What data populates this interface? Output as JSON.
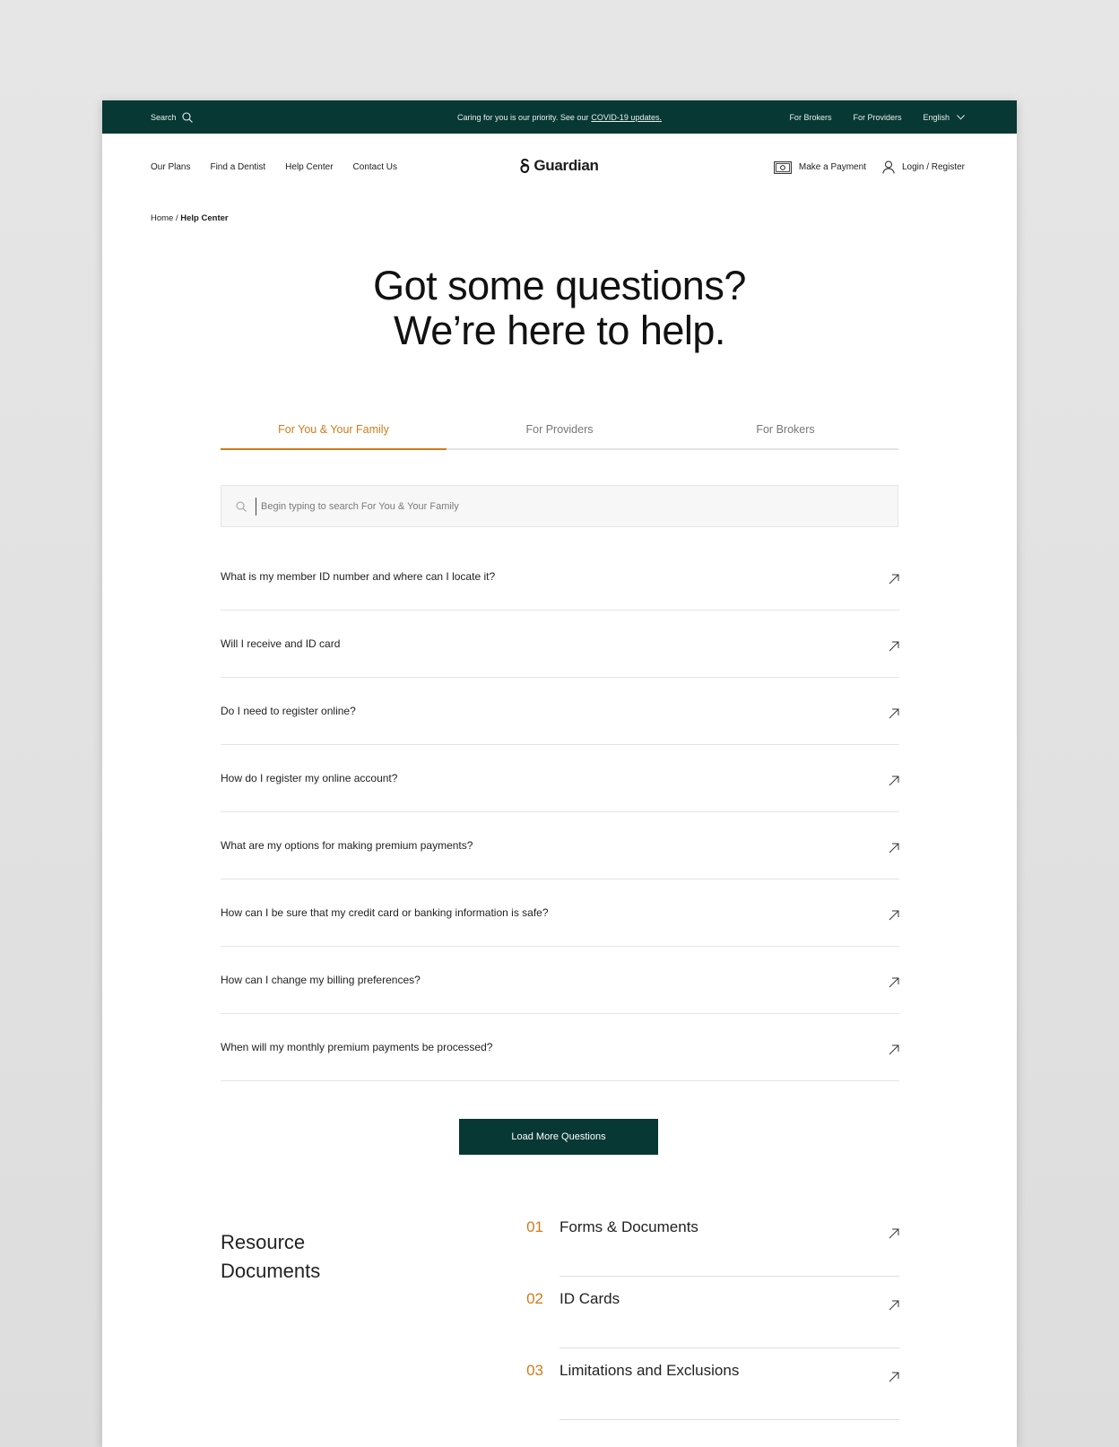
{
  "topbar": {
    "search_label": "Search",
    "notice_text": "Caring for you is our priority. See our",
    "notice_link": "COVID-19 updates.",
    "brokers": "For Brokers",
    "providers": "For Providers",
    "language": "English"
  },
  "nav": {
    "links": [
      "Our Plans",
      "Find a Dentist",
      "Help Center",
      "Contact Us"
    ],
    "logo": "Guardian",
    "payment": "Make a Payment",
    "login": "Login / Register"
  },
  "breadcrumb": {
    "home": "Home /",
    "current": "Help Center"
  },
  "hero": {
    "line1": "Got some questions?",
    "line2": "We’re here to help."
  },
  "tabs": [
    {
      "label": "For You & Your Family",
      "active": true
    },
    {
      "label": "For Providers",
      "active": false
    },
    {
      "label": "For Brokers",
      "active": false
    }
  ],
  "search": {
    "placeholder": "Begin typing to search For You & Your Family"
  },
  "faq": [
    "What is my member ID number and where can I locate it?",
    "Will I receive and ID card",
    "Do I need to register online?",
    "How do I register my online account?",
    "What are my options for making premium payments?",
    "How can I be sure that my credit card or banking information is safe?",
    "How can I change my billing preferences?",
    "When will my monthly premium payments be processed?"
  ],
  "load_more": "Load More Questions",
  "resources": {
    "title_line1": "Resource",
    "title_line2": "Documents",
    "items": [
      {
        "num": "01",
        "label": "Forms & Documents"
      },
      {
        "num": "02",
        "label": "ID Cards"
      },
      {
        "num": "03",
        "label": "Limitations and Exclusions"
      }
    ]
  },
  "colors": {
    "brand_green": "#073833",
    "accent_orange": "#d07b1c"
  }
}
